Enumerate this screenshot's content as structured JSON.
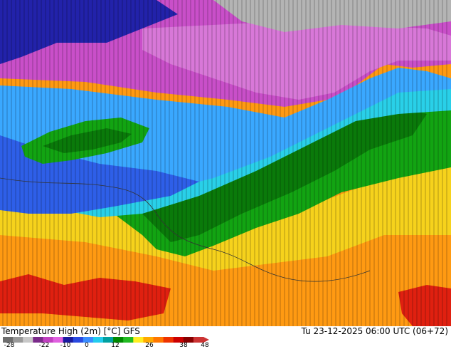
{
  "title": "Temperature High (2m) [°C] GFS",
  "datetime": "Tu 23-12-2025 06:00 UTC (06+72)",
  "colorbar": {
    "ticks": [
      "-28",
      "-22",
      "-10",
      "0",
      "12",
      "26",
      "38",
      "48"
    ],
    "colors": [
      "#6e6e6e",
      "#9a9a9a",
      "#c8c8c8",
      "#7a2a8a",
      "#c040c0",
      "#e060e0",
      "#1a1aa0",
      "#2a4ae0",
      "#3a8cff",
      "#22ccee",
      "#00a0a0",
      "#008800",
      "#22bb22",
      "#ffee22",
      "#ffaa00",
      "#ff7700",
      "#ee3300",
      "#cc0000",
      "#880000",
      "#cc3333"
    ]
  },
  "map": {
    "colors": {
      "grey": "#b4b4b4",
      "violet": "#c94fc9",
      "light_violet": "#d878d8",
      "dark_blue": "#2222aa",
      "blue": "#2e5fe8",
      "light_blue": "#3aa8ff",
      "cyan": "#29d0e8",
      "dark_green": "#0a7a0a",
      "green": "#12a412",
      "yellow": "#f6d21c",
      "orange": "#ff9a12",
      "red": "#e02010"
    },
    "isoline_values": [
      "-15",
      "-12",
      "-9",
      "-6",
      "-3",
      "0",
      "3",
      "6",
      "9",
      "12",
      "15",
      "18",
      "21",
      "24"
    ]
  }
}
